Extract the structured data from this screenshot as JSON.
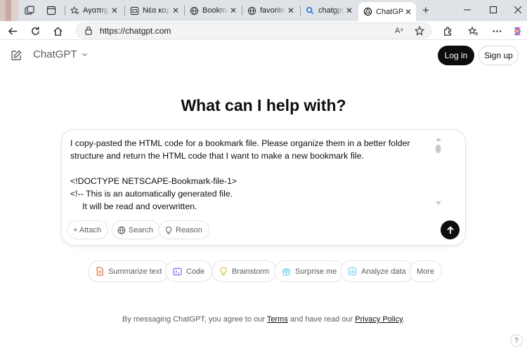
{
  "browser": {
    "tabs": [
      {
        "title": "Αγαπημένα",
        "icon": "star-list-icon"
      },
      {
        "title": "Νέα καρτέλα",
        "icon": "newtab-page-icon"
      },
      {
        "title": "Bookmarks",
        "icon": "globe-icon"
      },
      {
        "title": "favorites",
        "icon": "globe-icon"
      },
      {
        "title": "chatgpt",
        "icon": "search-icon"
      },
      {
        "title": "ChatGPT",
        "icon": "openai-icon"
      }
    ],
    "close_glyph": "✕",
    "new_tab_glyph": "+",
    "window_controls": {
      "minimize": "—",
      "maximize": "☐",
      "close": "✕"
    },
    "address": {
      "url": "https://chatgpt.com",
      "read_aloud": "A⁴"
    }
  },
  "page": {
    "brand": "ChatGPT",
    "login": "Log in",
    "signup": "Sign up",
    "headline": "What can I help with?",
    "composer": {
      "line1": "I copy-pasted the HTML code for a bookmark file. Please organize them in a better folder structure and return the HTML code that I want to make a new bookmark file.",
      "line2": "",
      "line3": "<!DOCTYPE NETSCAPE-Bookmark-file-1>",
      "line4": "<!-- This is an automatically generated file.",
      "line5": "     It will be read and overwritten.",
      "attach": "+ Attach",
      "search": "Search",
      "reason": "Reason"
    },
    "suggestions": [
      {
        "label": "Summarize text",
        "icon": "document-icon",
        "color": "#e2733c"
      },
      {
        "label": "Code",
        "icon": "terminal-icon",
        "color": "#6c71ff"
      },
      {
        "label": "Brainstorm",
        "icon": "lightbulb-icon",
        "color": "#e2c541"
      },
      {
        "label": "Surprise me",
        "icon": "gift-icon",
        "color": "#76d0eb"
      },
      {
        "label": "Analyze data",
        "icon": "chart-icon",
        "color": "#76d0eb"
      },
      {
        "label": "More",
        "icon": "",
        "color": ""
      }
    ],
    "footer": {
      "prefix": "By messaging ChatGPT, you agree to our ",
      "terms": "Terms",
      "middle": " and have read our ",
      "privacy": "Privacy Policy",
      "suffix": "."
    },
    "help": "?"
  }
}
